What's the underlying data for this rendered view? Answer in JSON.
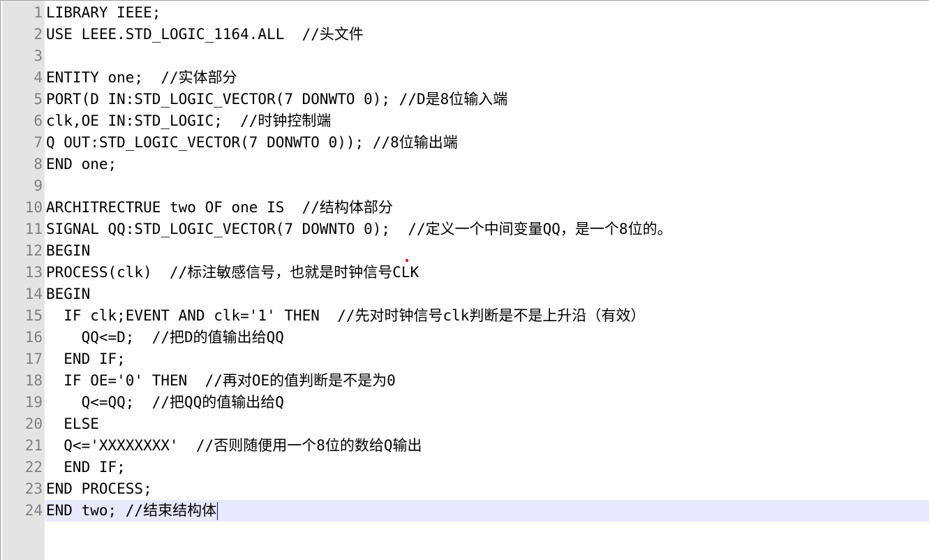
{
  "editor": {
    "lines": [
      {
        "number": "1",
        "text": "LIBRARY IEEE;"
      },
      {
        "number": "2",
        "text": "USE LEEE.STD_LOGIC_1164.ALL  //头文件"
      },
      {
        "number": "3",
        "text": ""
      },
      {
        "number": "4",
        "text": "ENTITY one;  //实体部分"
      },
      {
        "number": "5",
        "text": "PORT(D IN:STD_LOGIC_VECTOR(7 DONWTO 0); //D是8位输入端"
      },
      {
        "number": "6",
        "text": "clk,OE IN:STD_LOGIC;  //时钟控制端"
      },
      {
        "number": "7",
        "text": "Q OUT:STD_LOGIC_VECTOR(7 DONWTO 0)); //8位输出端"
      },
      {
        "number": "8",
        "text": "END one;"
      },
      {
        "number": "9",
        "text": ""
      },
      {
        "number": "10",
        "text": "ARCHITRECTRUE two OF one IS  //结构体部分"
      },
      {
        "number": "11",
        "text": "SIGNAL QQ:STD_LOGIC_VECTOR(7 DOWNTO 0);  //定义一个中间变量QQ，是一个8位的。"
      },
      {
        "number": "12",
        "text": "BEGIN"
      },
      {
        "number": "13",
        "text": "PROCESS(clk)  //标注敏感信号，也就是时钟信号CLK"
      },
      {
        "number": "14",
        "text": "BEGIN"
      },
      {
        "number": "15",
        "text": "  IF clk;EVENT AND clk='1' THEN  //先对时钟信号clk判断是不是上升沿（有效）"
      },
      {
        "number": "16",
        "text": "    QQ<=D;  //把D的值输出给QQ"
      },
      {
        "number": "17",
        "text": "  END IF;"
      },
      {
        "number": "18",
        "text": "  IF OE='0' THEN  //再对OE的值判断是不是为0"
      },
      {
        "number": "19",
        "text": "    Q<=QQ;  //把QQ的值输出给Q"
      },
      {
        "number": "20",
        "text": "  ELSE"
      },
      {
        "number": "21",
        "text": "  Q<='XXXXXXXX'  //否则随便用一个8位的数给Q输出"
      },
      {
        "number": "22",
        "text": "  END IF;"
      },
      {
        "number": "23",
        "text": "END PROCESS;"
      },
      {
        "number": "24",
        "text": "END two; //结束结构体"
      }
    ],
    "current_line": "24",
    "current_line_color": "#e8e8ff",
    "gutter_color": "#e4e4e4",
    "line_number_color": "#808080",
    "caret_color": "#0000ff"
  }
}
